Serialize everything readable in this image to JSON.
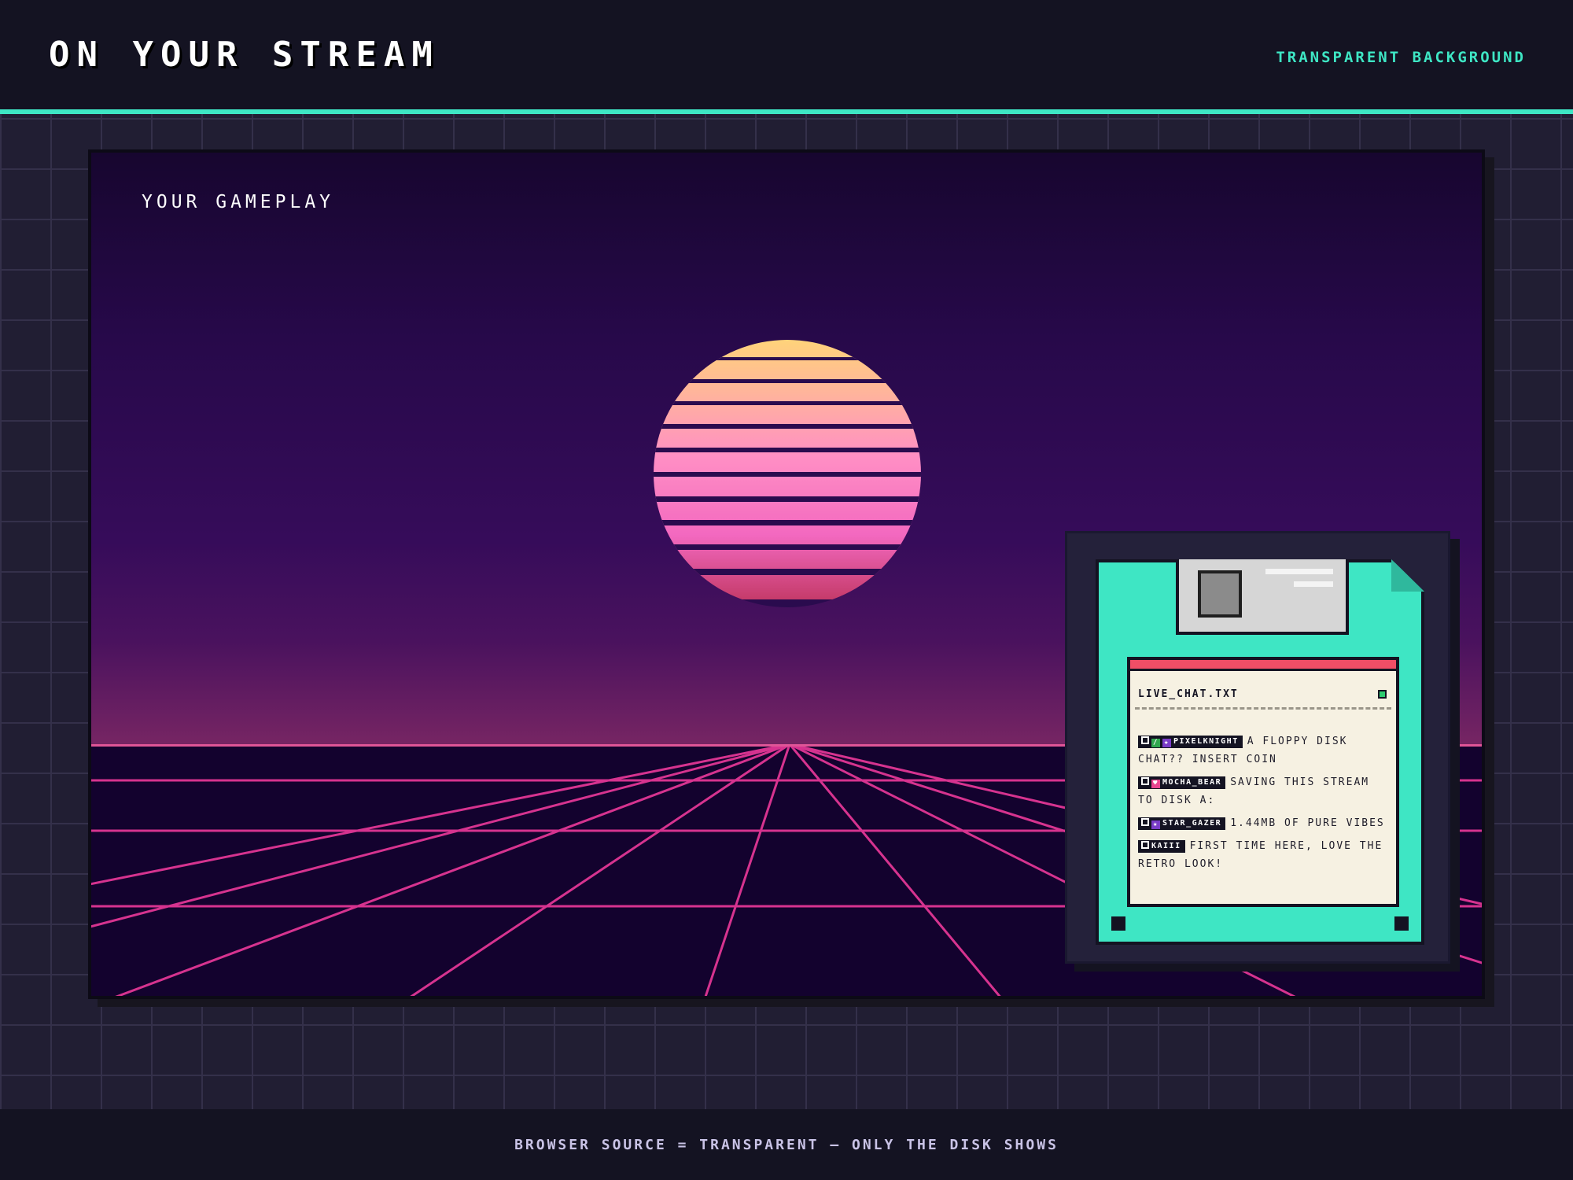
{
  "header": {
    "title": "ON YOUR STREAM",
    "tag": "TRANSPARENT BACKGROUND"
  },
  "stage": {
    "label": "YOUR GAMEPLAY"
  },
  "disk": {
    "file_name": "LIVE_CHAT.TXT",
    "messages": [
      {
        "user": "PIXELKNIGHT",
        "badges": [
          "square-badge-icon",
          "sword-badge-icon",
          "star-badge-icon"
        ],
        "text": "A FLOPPY DISK CHAT?? INSERT COIN"
      },
      {
        "user": "MOCHA_BEAR",
        "badges": [
          "square-badge-icon",
          "heart-badge-icon"
        ],
        "text": "SAVING THIS STREAM TO DISK A:"
      },
      {
        "user": "STAR_GAZER",
        "badges": [
          "square-badge-icon",
          "star-badge-icon"
        ],
        "text": "1.44MB OF PURE VIBES"
      },
      {
        "user": "KAIII",
        "badges": [
          "square-badge-icon"
        ],
        "text": "FIRST TIME HERE, LOVE THE RETRO LOOK!"
      }
    ]
  },
  "footer": {
    "text": "BROWSER SOURCE = TRANSPARENT — ONLY THE DISK SHOWS"
  },
  "colors": {
    "accent": "#3ee6c4",
    "header_bg": "#141322",
    "grid_line": "#d6338f",
    "label_stripe": "#f04e66",
    "led": "#2ecb70"
  }
}
